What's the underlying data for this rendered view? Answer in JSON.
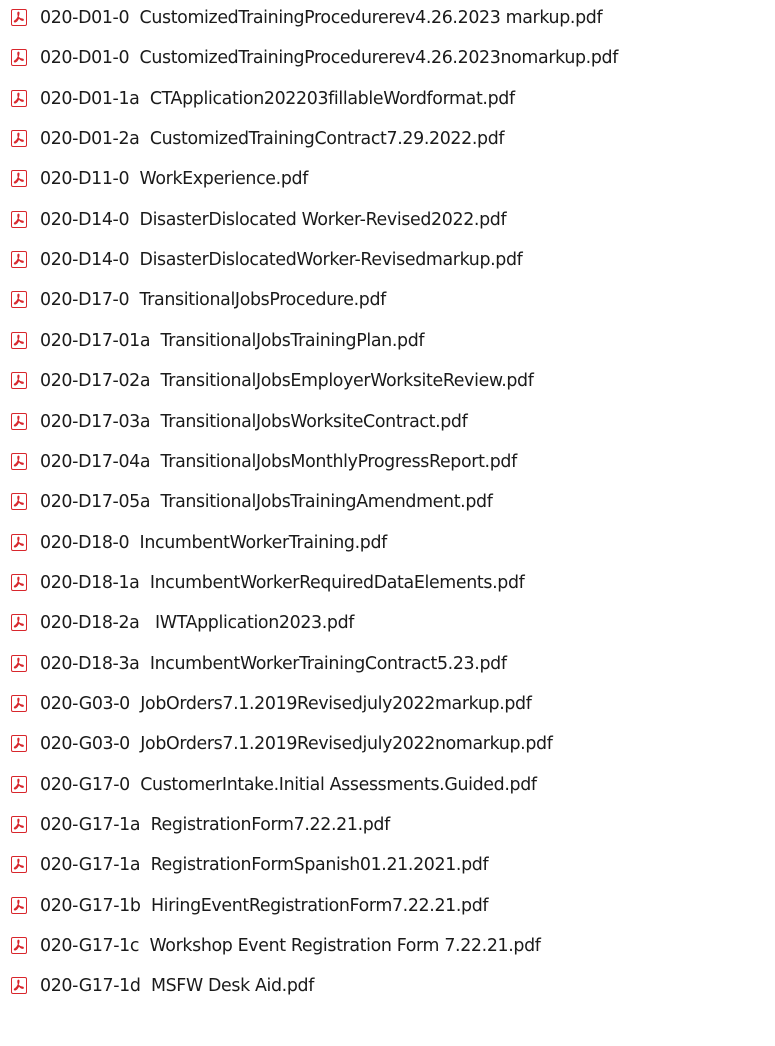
{
  "files": [
    {
      "name": "020-D01-0  CustomizedTrainingProcedurerev4.26.2023 markup.pdf",
      "icon": "pdf-icon"
    },
    {
      "name": "020-D01-0  CustomizedTrainingProcedurerev4.26.2023nomarkup.pdf",
      "icon": "pdf-icon"
    },
    {
      "name": "020-D01-1a  CTApplication202203fillableWordformat.pdf",
      "icon": "pdf-icon"
    },
    {
      "name": "020-D01-2a  CustomizedTrainingContract7.29.2022.pdf",
      "icon": "pdf-icon"
    },
    {
      "name": "020-D11-0  WorkExperience.pdf",
      "icon": "pdf-icon"
    },
    {
      "name": "020-D14-0  DisasterDislocated Worker-Revised2022.pdf",
      "icon": "pdf-icon"
    },
    {
      "name": "020-D14-0  DisasterDislocatedWorker-Revisedmarkup.pdf",
      "icon": "pdf-icon"
    },
    {
      "name": "020-D17-0  TransitionalJobsProcedure.pdf",
      "icon": "pdf-icon"
    },
    {
      "name": "020-D17-01a  TransitionalJobsTrainingPlan.pdf",
      "icon": "pdf-icon"
    },
    {
      "name": "020-D17-02a  TransitionalJobsEmployerWorksiteReview.pdf",
      "icon": "pdf-icon"
    },
    {
      "name": "020-D17-03a  TransitionalJobsWorksiteContract.pdf",
      "icon": "pdf-icon"
    },
    {
      "name": "020-D17-04a  TransitionalJobsMonthlyProgressReport.pdf",
      "icon": "pdf-icon"
    },
    {
      "name": "020-D17-05a  TransitionalJobsTrainingAmendment.pdf",
      "icon": "pdf-icon"
    },
    {
      "name": "020-D18-0  IncumbentWorkerTraining.pdf",
      "icon": "pdf-icon"
    },
    {
      "name": "020-D18-1a  IncumbentWorkerRequiredDataElements.pdf",
      "icon": "pdf-icon"
    },
    {
      "name": "020-D18-2a   IWTApplication2023.pdf",
      "icon": "pdf-icon"
    },
    {
      "name": "020-D18-3a  IncumbentWorkerTrainingContract5.23.pdf",
      "icon": "pdf-icon"
    },
    {
      "name": "020-G03-0  JobOrders7.1.2019Revisedjuly2022markup.pdf",
      "icon": "pdf-icon"
    },
    {
      "name": "020-G03-0  JobOrders7.1.2019Revisedjuly2022nomarkup.pdf",
      "icon": "pdf-icon"
    },
    {
      "name": "020-G17-0  CustomerIntake.Initial Assessments.Guided.pdf",
      "icon": "pdf-icon"
    },
    {
      "name": "020-G17-1a  RegistrationForm7.22.21.pdf",
      "icon": "pdf-icon"
    },
    {
      "name": "020-G17-1a  RegistrationFormSpanish01.21.2021.pdf",
      "icon": "pdf-icon"
    },
    {
      "name": "020-G17-1b  HiringEventRegistrationForm7.22.21.pdf",
      "icon": "pdf-icon"
    },
    {
      "name": "020-G17-1c  Workshop Event Registration Form 7.22.21.pdf",
      "icon": "pdf-icon"
    },
    {
      "name": "020-G17-1d  MSFW Desk Aid.pdf",
      "icon": "pdf-icon"
    }
  ],
  "colors": {
    "icon_accent": "#d8262c",
    "text": "#1a1a1a",
    "background": "#ffffff"
  }
}
